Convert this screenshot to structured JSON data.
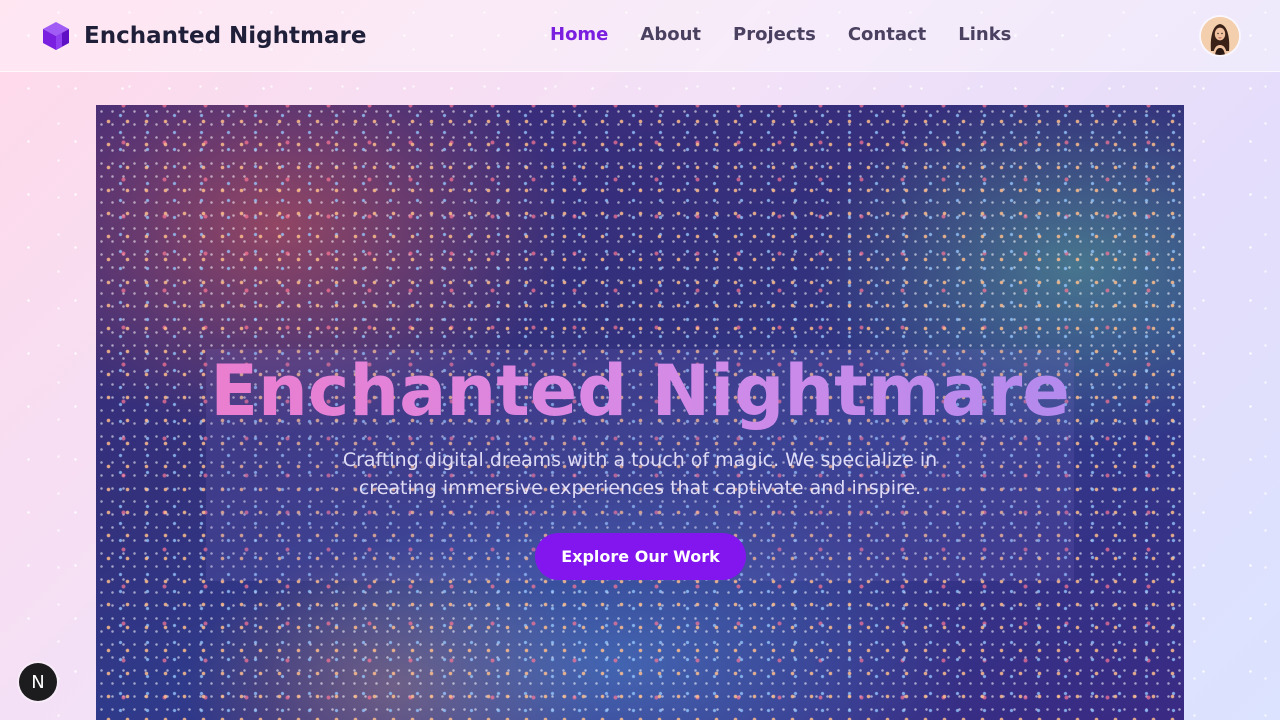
{
  "header": {
    "brand_name": "Enchanted Nightmare",
    "brand_icon": "cube-icon",
    "nav": [
      {
        "label": "Home",
        "active": true
      },
      {
        "label": "About",
        "active": false
      },
      {
        "label": "Projects",
        "active": false
      },
      {
        "label": "Contact",
        "active": false
      },
      {
        "label": "Links",
        "active": false
      }
    ],
    "avatar_icon": "user-avatar"
  },
  "hero": {
    "title": "Enchanted Nightmare",
    "subtitle": "Crafting digital dreams with a touch of magic. We specialize in creating immersive experiences that captivate and inspire.",
    "cta_label": "Explore Our Work"
  },
  "dev_badge": {
    "label": "N",
    "icon": "nextjs-icon"
  },
  "colors": {
    "accent": "#8315ee",
    "nav_active": "#7a1fe0",
    "brand_text": "#1f1f3a"
  }
}
